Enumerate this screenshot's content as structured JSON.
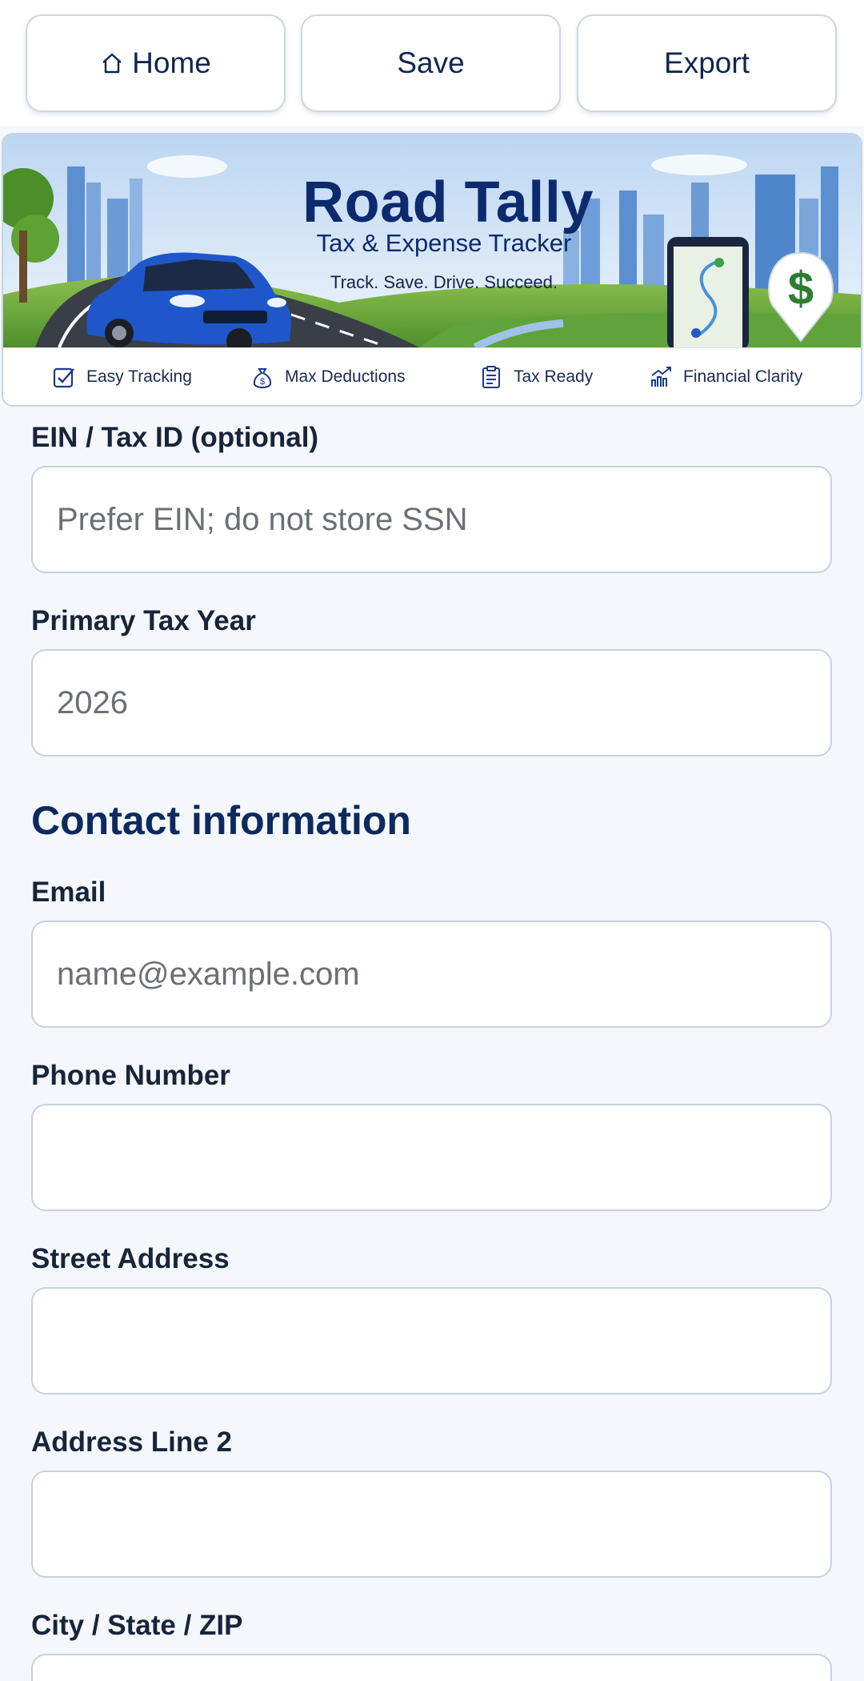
{
  "nav": {
    "home_label": "Home",
    "save_label": "Save",
    "export_label": "Export"
  },
  "banner": {
    "title": "Road Tally",
    "subtitle": "Tax & Expense Tracker",
    "tagline": "Track. Save. Drive. Succeed.",
    "pin_symbol": "$",
    "features": [
      {
        "label": "Easy Tracking",
        "icon": "checkbox-icon"
      },
      {
        "label": "Max Deductions",
        "icon": "money-bag-icon"
      },
      {
        "label": "Tax Ready",
        "icon": "clipboard-icon"
      },
      {
        "label": "Financial Clarity",
        "icon": "growth-chart-icon"
      }
    ]
  },
  "form": {
    "ein": {
      "label": "EIN / Tax ID (optional)",
      "placeholder": "Prefer EIN; do not store SSN",
      "value": ""
    },
    "tax_year": {
      "label": "Primary Tax Year",
      "placeholder": "2026",
      "value": ""
    },
    "contact_heading": "Contact information",
    "email": {
      "label": "Email",
      "placeholder": "name@example.com",
      "value": ""
    },
    "phone": {
      "label": "Phone Number",
      "placeholder": "",
      "value": ""
    },
    "street": {
      "label": "Street Address",
      "placeholder": "",
      "value": ""
    },
    "address2": {
      "label": "Address Line 2",
      "placeholder": "",
      "value": ""
    },
    "city_state_zip": {
      "label": "City / State / ZIP",
      "placeholder": "",
      "value": ""
    }
  },
  "colors": {
    "brand_navy": "#0d2a6e",
    "background": "#f4f7fb",
    "field_border": "#c8d1df",
    "pin_green": "#2e7d32"
  }
}
